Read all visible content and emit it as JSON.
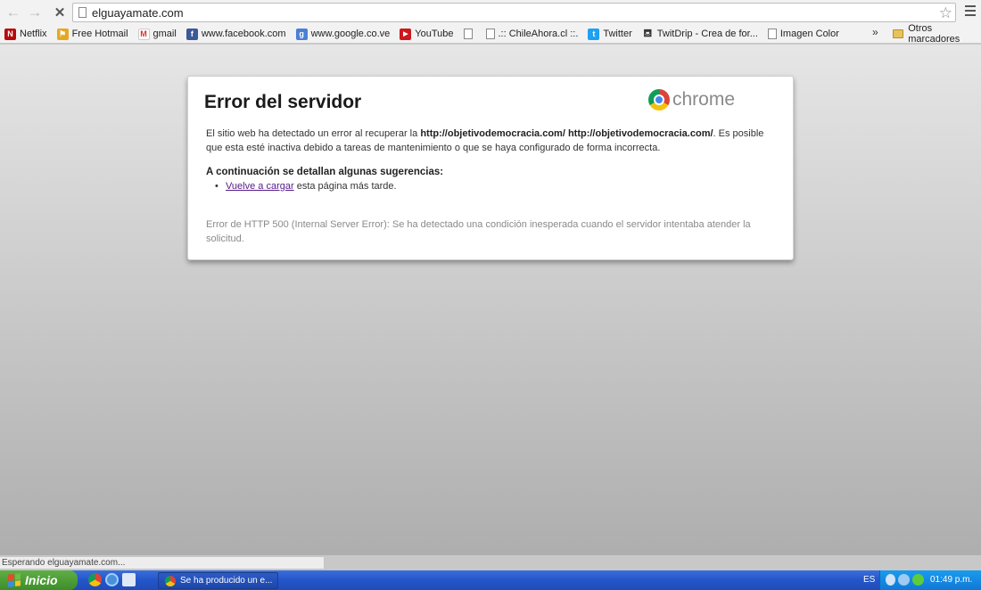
{
  "toolbar": {
    "url": "elguayamate.com"
  },
  "bookmarks": [
    {
      "label": "Netflix",
      "icon": "netflix-icon",
      "color": "#b9090b"
    },
    {
      "label": "Free Hotmail",
      "icon": "windows-flag-icon",
      "color": "#e6a823"
    },
    {
      "label": "gmail",
      "icon": "gmail-icon",
      "color": "#d93025"
    },
    {
      "label": "www.facebook.com",
      "icon": "facebook-icon",
      "color": "#3b5998"
    },
    {
      "label": "www.google.co.ve",
      "icon": "google-icon",
      "color": "#4a7fd4"
    },
    {
      "label": "YouTube",
      "icon": "youtube-icon",
      "color": "#cc181e"
    },
    {
      "label": "",
      "icon": "page-icon",
      "color": "#ffffff"
    },
    {
      "label": ".:: ChileAhora.cl ::.",
      "icon": "page-icon",
      "color": "#ffffff"
    },
    {
      "label": "Twitter",
      "icon": "twitter-icon",
      "color": "#1da1f2"
    },
    {
      "label": "TwitDrip - Crea de for...",
      "icon": "twitdrip-icon",
      "color": "#333333"
    },
    {
      "label": "Imagen Color",
      "icon": "page-icon",
      "color": "#ffffff"
    }
  ],
  "bookmarks_overflow": "»",
  "other_bookmarks": "Otros marcadores",
  "error": {
    "title": "Error del servidor",
    "brand": "chrome",
    "body_prefix": "El sitio web ha detectado un error al recuperar la ",
    "body_url": "http://objetivodemocracia.com/ http://objetivodemocracia.com/",
    "body_suffix": ". Es posible que esta esté inactiva debido a tareas de mantenimiento o que se haya configurado de forma incorrecta.",
    "suggestions_heading": "A continuación se detallan algunas sugerencias:",
    "reload_link": "Vuelve a cargar",
    "reload_suffix": " esta página más tarde.",
    "detail": "Error de HTTP 500 (Internal Server Error): Se ha detectado una condición inesperada cuando el servidor intentaba atender la solicitud."
  },
  "status_text": "Esperando elguayamate.com...",
  "taskbar": {
    "start_label": "Inicio",
    "task_label": "Se ha producido un e...",
    "language": "ES",
    "clock": "01:49 p.m."
  }
}
